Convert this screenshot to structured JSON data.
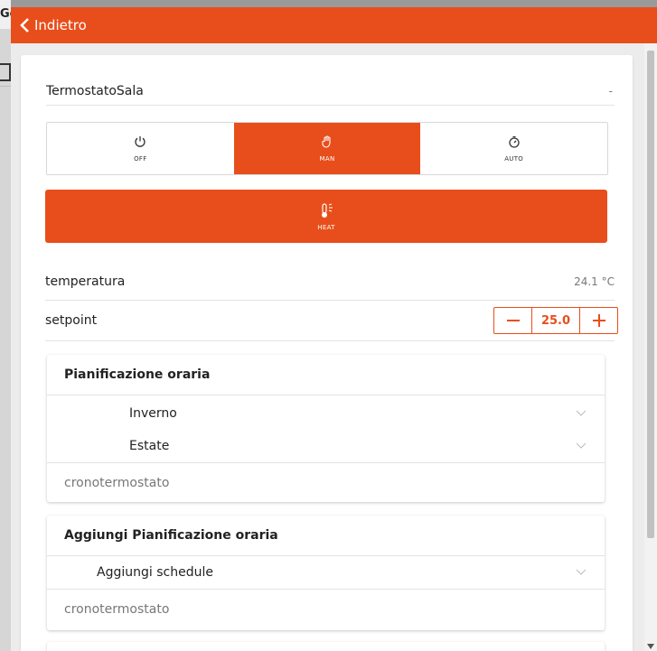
{
  "background": {
    "partial_title": "Ge"
  },
  "header": {
    "back_label": "Indietro",
    "accent": "#e84e1b"
  },
  "device": {
    "name": "TermostatoSala",
    "menu": "-"
  },
  "modes": [
    {
      "label": "OFF",
      "icon": "power-icon",
      "active": false
    },
    {
      "label": "MAN",
      "icon": "hand-icon",
      "active": true
    },
    {
      "label": "AUTO",
      "icon": "timer-icon",
      "active": false
    }
  ],
  "season": {
    "label": "HEAT",
    "icon": "thermometer-sun-icon"
  },
  "temperature": {
    "label": "temperatura",
    "value": "24.1 °C"
  },
  "setpoint": {
    "label": "setpoint",
    "value": "25.0",
    "minus": "—",
    "plus": "+"
  },
  "schedule_panel": {
    "title": "Pianificazione oraria",
    "items": [
      "Inverno",
      "Estate"
    ],
    "footer": "cronotermostato"
  },
  "add_schedule_panel": {
    "title": "Aggiungi Pianificazione oraria",
    "items": [
      "Aggiungi schedule"
    ],
    "footer": "cronotermostato"
  }
}
